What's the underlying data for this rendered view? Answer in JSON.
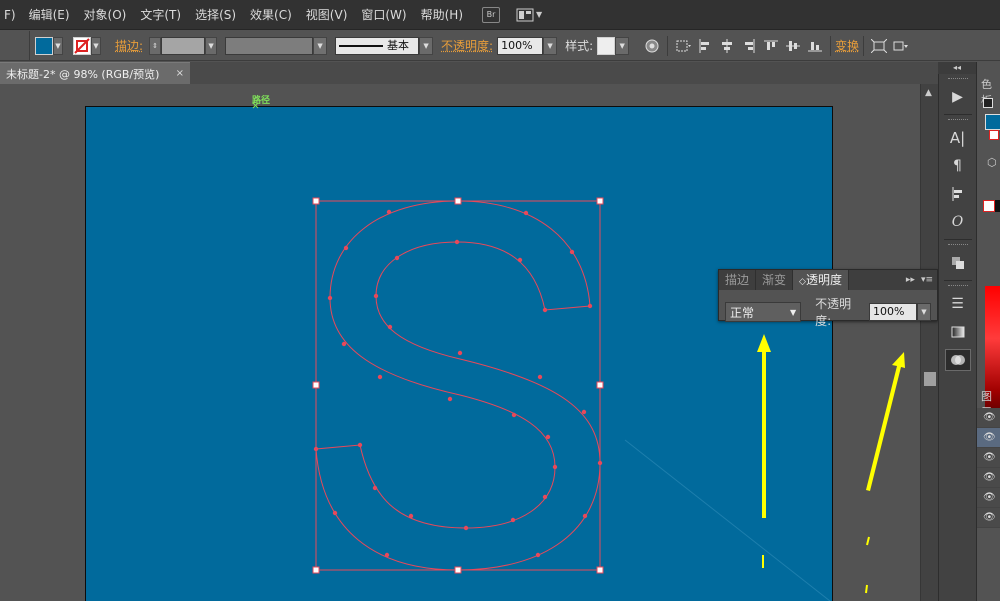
{
  "menubar": {
    "first": "F)",
    "items": [
      "编辑(E)",
      "对象(O)",
      "文字(T)",
      "选择(S)",
      "效果(C)",
      "视图(V)",
      "窗口(W)",
      "帮助(H)"
    ],
    "bridge_badge": "Br"
  },
  "controlbar": {
    "fill_color": "#016a9c",
    "stroke_label": "描边:",
    "brush_value": "基本",
    "opacity_label": "不透明度:",
    "opacity_value": "100%",
    "style_label": "样式:",
    "transform_label": "变换"
  },
  "document_tab": {
    "title": "未标题-2* @ 98% (RGB/预览)",
    "close": "×"
  },
  "canvas": {
    "artboard_color": "#016a9c",
    "path_tooltip": "路径",
    "path_color": "#e8495a",
    "arrow_color": "#ffff00"
  },
  "transparency_panel": {
    "tabs": [
      "描边",
      "渐变",
      "透明度"
    ],
    "active_tab_prefix": "◇",
    "blend_mode": "正常",
    "opacity_label": "不透明度:",
    "opacity_value": "100%"
  },
  "right_panel": {
    "color_tab": "色板",
    "layers_tab": "图层"
  }
}
